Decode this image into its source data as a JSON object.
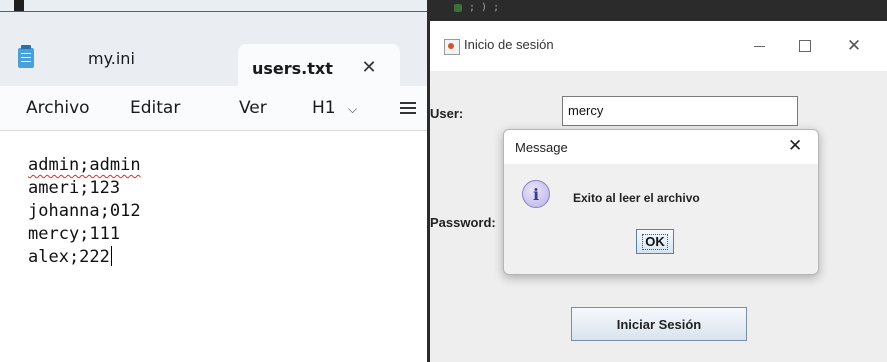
{
  "notepad": {
    "tabs": [
      {
        "label": "my.ini",
        "active": false
      },
      {
        "label": "users.txt",
        "active": true
      }
    ],
    "tab_close_glyph": "✕",
    "menu": {
      "archivo": "Archivo",
      "editar": "Editar",
      "ver": "Ver",
      "heading": "H1",
      "heading_chevron": "⌵"
    },
    "lines": [
      "admin;admin",
      "ameri;123",
      "johanna;012",
      "mercy;111",
      "alex;222"
    ],
    "icons": [
      "notepad-icon",
      "close-icon",
      "chevron-down-icon",
      "list-icon"
    ]
  },
  "login_window": {
    "title": "Inicio de sesión",
    "background_console_text": "; ) ;",
    "user_label": "User:",
    "user_value": "mercy",
    "password_label": "Password:",
    "login_button": "Iniciar Sesión",
    "title_buttons": {
      "minimize": "—",
      "maximize": "☐",
      "close": "✕"
    }
  },
  "message_dialog": {
    "title": "Message",
    "close_glyph": "✕",
    "info_glyph": "i",
    "message": "Exito al leer el archivo",
    "ok_button": "OK"
  },
  "colors": {
    "notepad_tabbar": "#eaeef3",
    "swing_background": "#eeeeee",
    "button_border": "#7a8ea5",
    "spellcheck_underline": "#d93025"
  }
}
